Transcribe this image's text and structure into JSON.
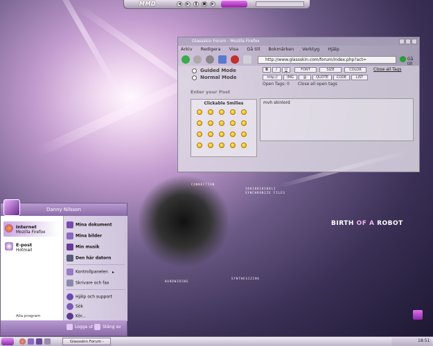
{
  "browser": {
    "title": "Glassskin Forum - Mozilla Firefox",
    "menu": [
      "Arkiv",
      "Redigera",
      "Visa",
      "Gå till",
      "Bokmärken",
      "Verktyg",
      "Hjälp"
    ],
    "url": "http://www.glassskin.com/forum/index.php?act=",
    "go_label": "Gå till",
    "guided_mode": "Guided Mode",
    "normal_mode": "Normal Mode",
    "format_buttons_row1": [
      "B",
      "I",
      "U",
      "FONT",
      "SIZE",
      "COLOR"
    ],
    "format_buttons_row2": [
      "http://",
      "IMG",
      "@",
      "QUOTE",
      "CODE",
      "LIST"
    ],
    "close_all_tags": "Close all Tags",
    "open_tags_label": "Open Tags:",
    "open_tags_count": "0",
    "close_all_open_tags": "Close all open tags",
    "enter_post": "Enter your Post",
    "clickable_smilies": "Clickable Smilies",
    "post_text": "mvh skinlord"
  },
  "wallpaper": {
    "headline_birth": "BIRTH",
    "headline_of": "OF A",
    "headline_robot": "ROBOT",
    "small_text_1": "CONNECTION",
    "small_text_2": "1001001010011",
    "small_text_3": "SYNCHRONIZE FILES",
    "small_text_4": "SYNTHESIZING",
    "small_text_5": "HARDWIRING"
  },
  "start_menu": {
    "user_name": "Danny Nilsson",
    "pinned": [
      {
        "title": "Internet",
        "subtitle": "Mozilla Firefox"
      },
      {
        "title": "E-post",
        "subtitle": "Hotmail"
      }
    ],
    "all_programs": "Alla program",
    "right_items": [
      "Mina dokument",
      "Mina bilder",
      "Min musik",
      "Den här datorn",
      "Kontrollpanelen",
      "Skrivare och fax",
      "Hjälp och support",
      "Sök",
      "Kör..."
    ],
    "log_off": "Logga ut",
    "shut_down": "Stäng av"
  },
  "taskbar": {
    "task_label": "Glassskin Forum -",
    "clock": "18:51"
  },
  "colors": {
    "accent": "#9a3ab8",
    "window_glass": "#cdc8d7"
  }
}
